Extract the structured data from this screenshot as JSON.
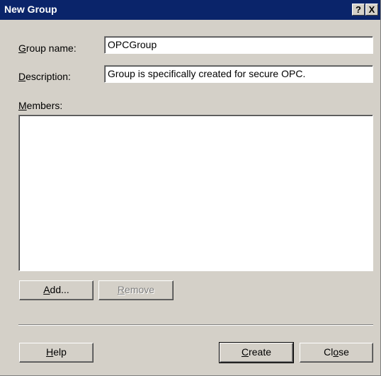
{
  "window": {
    "title": "New Group",
    "help_button": "?",
    "close_button": "X"
  },
  "form": {
    "group_name": {
      "label_accel": "G",
      "label_rest": "roup name:",
      "value": "OPCGroup"
    },
    "description": {
      "label_accel": "D",
      "label_rest": "escription:",
      "value": "Group is specifically created for secure OPC."
    },
    "members": {
      "label_accel": "M",
      "label_rest": "embers:",
      "items": []
    }
  },
  "buttons": {
    "add": {
      "accel": "A",
      "rest": "dd..."
    },
    "remove": {
      "accel": "R",
      "rest": "emove",
      "disabled": true
    },
    "help": {
      "accel": "H",
      "rest": "elp"
    },
    "create": {
      "accel": "C",
      "rest": "reate"
    },
    "close_pre": "Cl",
    "close_accel": "o",
    "close_post": "se"
  }
}
